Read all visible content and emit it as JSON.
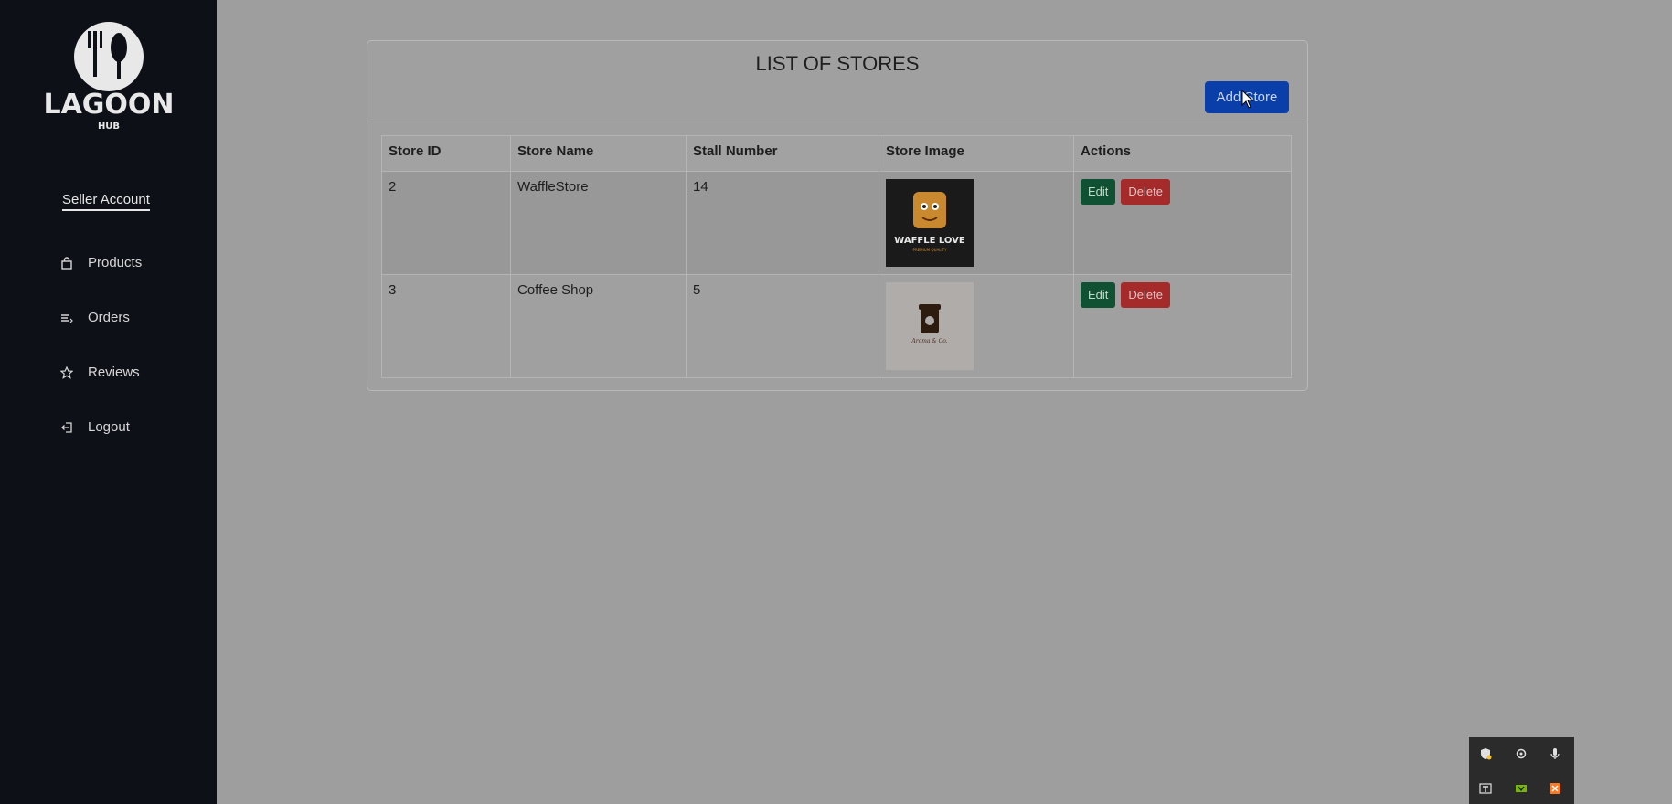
{
  "app": {
    "logo_text": "LAGOON",
    "logo_sub": "HUB"
  },
  "sidebar": {
    "account_label": "Seller Account",
    "items": [
      {
        "label": "Products",
        "icon": "shopping-bag-icon"
      },
      {
        "label": "Orders",
        "icon": "list-icon"
      },
      {
        "label": "Reviews",
        "icon": "star-icon"
      },
      {
        "label": "Logout",
        "icon": "logout-icon"
      }
    ]
  },
  "main": {
    "title": "LIST OF STORES",
    "add_button": "Add Store",
    "table": {
      "headers": [
        "Store ID",
        "Store Name",
        "Stall Number",
        "Store Image",
        "Actions"
      ],
      "rows": [
        {
          "id": "2",
          "name": "WaffleStore",
          "stall": "14",
          "image_text": "WAFFLE LOVE",
          "image_subtext": "PREMIUM QUALITY",
          "edit": "Edit",
          "delete": "Delete"
        },
        {
          "id": "3",
          "name": "Coffee Shop",
          "stall": "5",
          "image_text": "Aroma & Co.",
          "image_subtext": "",
          "edit": "Edit",
          "delete": "Delete"
        }
      ]
    }
  },
  "colors": {
    "sidebar_bg": "#0d1117",
    "primary": "#0a3ea8",
    "success": "#0f5132",
    "danger": "#a52a2a",
    "overlay": "#9e9e9e"
  }
}
